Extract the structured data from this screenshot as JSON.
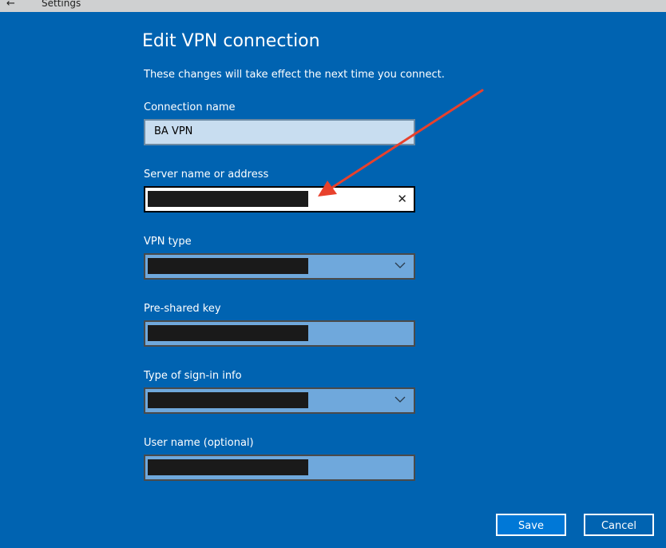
{
  "window": {
    "back_icon": "←",
    "title": "Settings"
  },
  "dialog": {
    "heading": "Edit VPN connection",
    "subtitle": "These changes will take effect the next time you connect.",
    "fields": {
      "connection_name": {
        "label": "Connection name",
        "value": "BA VPN"
      },
      "server": {
        "label": "Server name or address",
        "clear_icon": "✕"
      },
      "vpn_type": {
        "label": "VPN type"
      },
      "psk": {
        "label": "Pre-shared key"
      },
      "signin": {
        "label": "Type of sign-in info"
      },
      "username": {
        "label": "User name (optional)"
      }
    },
    "buttons": {
      "save": "Save",
      "cancel": "Cancel"
    }
  },
  "colors": {
    "background": "#0063b1",
    "annotation_arrow": "#e8412c"
  },
  "icons": {
    "back": "back-arrow-icon",
    "clear": "clear-x-icon",
    "dropdown": "chevron-down-icon",
    "annotation": "red-arrow-annotation"
  }
}
